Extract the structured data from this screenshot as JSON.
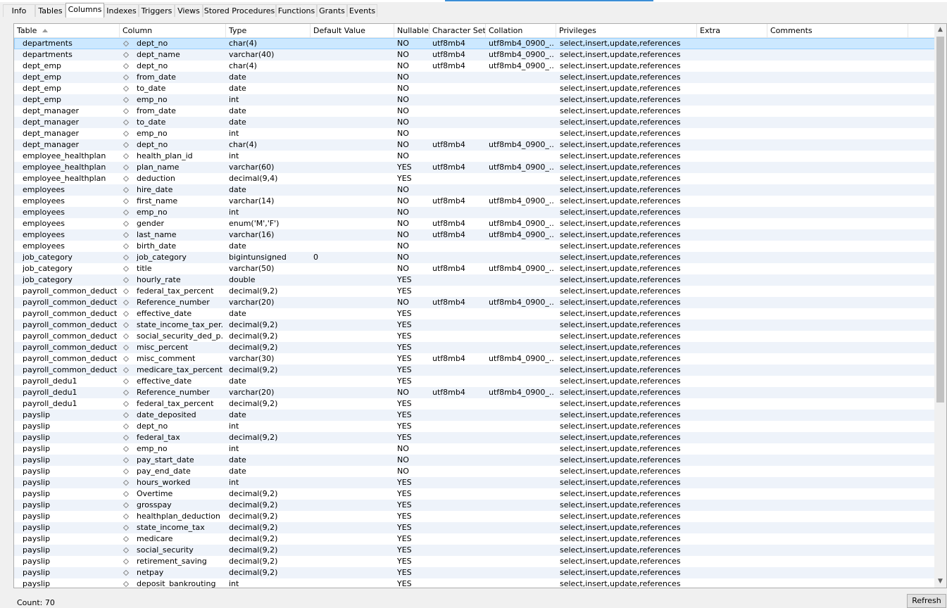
{
  "tabs": [
    "Info",
    "Tables",
    "Columns",
    "Indexes",
    "Triggers",
    "Views",
    "Stored Procedures",
    "Functions",
    "Grants",
    "Events"
  ],
  "active_tab": "Columns",
  "columns": [
    "Table",
    "Column",
    "Type",
    "Default Value",
    "Nullable",
    "Character Set",
    "Collation",
    "Privileges",
    "Extra",
    "Comments"
  ],
  "sorted_column": "Table",
  "rows": [
    [
      "departments",
      "dept_no",
      "char(4)",
      "",
      "NO",
      "utf8mb4",
      "utf8mb4_0900_...",
      "select,insert,update,references",
      "",
      ""
    ],
    [
      "departments",
      "dept_name",
      "varchar(40)",
      "",
      "NO",
      "utf8mb4",
      "utf8mb4_0900_...",
      "select,insert,update,references",
      "",
      ""
    ],
    [
      "dept_emp",
      "dept_no",
      "char(4)",
      "",
      "NO",
      "utf8mb4",
      "utf8mb4_0900_...",
      "select,insert,update,references",
      "",
      ""
    ],
    [
      "dept_emp",
      "from_date",
      "date",
      "",
      "NO",
      "",
      "",
      "select,insert,update,references",
      "",
      ""
    ],
    [
      "dept_emp",
      "to_date",
      "date",
      "",
      "NO",
      "",
      "",
      "select,insert,update,references",
      "",
      ""
    ],
    [
      "dept_emp",
      "emp_no",
      "int",
      "",
      "NO",
      "",
      "",
      "select,insert,update,references",
      "",
      ""
    ],
    [
      "dept_manager",
      "from_date",
      "date",
      "",
      "NO",
      "",
      "",
      "select,insert,update,references",
      "",
      ""
    ],
    [
      "dept_manager",
      "to_date",
      "date",
      "",
      "NO",
      "",
      "",
      "select,insert,update,references",
      "",
      ""
    ],
    [
      "dept_manager",
      "emp_no",
      "int",
      "",
      "NO",
      "",
      "",
      "select,insert,update,references",
      "",
      ""
    ],
    [
      "dept_manager",
      "dept_no",
      "char(4)",
      "",
      "NO",
      "utf8mb4",
      "utf8mb4_0900_...",
      "select,insert,update,references",
      "",
      ""
    ],
    [
      "employee_healthplan",
      "health_plan_id",
      "int",
      "",
      "NO",
      "",
      "",
      "select,insert,update,references",
      "",
      ""
    ],
    [
      "employee_healthplan",
      "plan_name",
      "varchar(60)",
      "",
      "YES",
      "utf8mb4",
      "utf8mb4_0900_...",
      "select,insert,update,references",
      "",
      ""
    ],
    [
      "employee_healthplan",
      "deduction",
      "decimal(9,4)",
      "",
      "YES",
      "",
      "",
      "select,insert,update,references",
      "",
      ""
    ],
    [
      "employees",
      "hire_date",
      "date",
      "",
      "NO",
      "",
      "",
      "select,insert,update,references",
      "",
      ""
    ],
    [
      "employees",
      "first_name",
      "varchar(14)",
      "",
      "NO",
      "utf8mb4",
      "utf8mb4_0900_...",
      "select,insert,update,references",
      "",
      ""
    ],
    [
      "employees",
      "emp_no",
      "int",
      "",
      "NO",
      "",
      "",
      "select,insert,update,references",
      "",
      ""
    ],
    [
      "employees",
      "gender",
      "enum('M','F')",
      "",
      "NO",
      "utf8mb4",
      "utf8mb4_0900_...",
      "select,insert,update,references",
      "",
      ""
    ],
    [
      "employees",
      "last_name",
      "varchar(16)",
      "",
      "NO",
      "utf8mb4",
      "utf8mb4_0900_...",
      "select,insert,update,references",
      "",
      ""
    ],
    [
      "employees",
      "birth_date",
      "date",
      "",
      "NO",
      "",
      "",
      "select,insert,update,references",
      "",
      ""
    ],
    [
      "job_category",
      "job_category",
      "bigintunsigned",
      "0",
      "NO",
      "",
      "",
      "select,insert,update,references",
      "",
      ""
    ],
    [
      "job_category",
      "title",
      "varchar(50)",
      "",
      "NO",
      "utf8mb4",
      "utf8mb4_0900_...",
      "select,insert,update,references",
      "",
      ""
    ],
    [
      "job_category",
      "hourly_rate",
      "double",
      "",
      "YES",
      "",
      "",
      "select,insert,update,references",
      "",
      ""
    ],
    [
      "payroll_common_deducti...",
      "federal_tax_percent",
      "decimal(9,2)",
      "",
      "YES",
      "",
      "",
      "select,insert,update,references",
      "",
      ""
    ],
    [
      "payroll_common_deducti...",
      "Reference_number",
      "varchar(20)",
      "",
      "NO",
      "utf8mb4",
      "utf8mb4_0900_...",
      "select,insert,update,references",
      "",
      ""
    ],
    [
      "payroll_common_deducti...",
      "effective_date",
      "date",
      "",
      "YES",
      "",
      "",
      "select,insert,update,references",
      "",
      ""
    ],
    [
      "payroll_common_deducti...",
      "state_income_tax_per...",
      "decimal(9,2)",
      "",
      "YES",
      "",
      "",
      "select,insert,update,references",
      "",
      ""
    ],
    [
      "payroll_common_deducti...",
      "social_security_ded_p...",
      "decimal(9,2)",
      "",
      "YES",
      "",
      "",
      "select,insert,update,references",
      "",
      ""
    ],
    [
      "payroll_common_deducti...",
      "misc_percent",
      "decimal(9,2)",
      "",
      "YES",
      "",
      "",
      "select,insert,update,references",
      "",
      ""
    ],
    [
      "payroll_common_deducti...",
      "misc_comment",
      "varchar(30)",
      "",
      "YES",
      "utf8mb4",
      "utf8mb4_0900_...",
      "select,insert,update,references",
      "",
      ""
    ],
    [
      "payroll_common_deducti...",
      "medicare_tax_percent",
      "decimal(9,2)",
      "",
      "YES",
      "",
      "",
      "select,insert,update,references",
      "",
      ""
    ],
    [
      "payroll_dedu1",
      "effective_date",
      "date",
      "",
      "YES",
      "",
      "",
      "select,insert,update,references",
      "",
      ""
    ],
    [
      "payroll_dedu1",
      "Reference_number",
      "varchar(20)",
      "",
      "NO",
      "utf8mb4",
      "utf8mb4_0900_...",
      "select,insert,update,references",
      "",
      ""
    ],
    [
      "payroll_dedu1",
      "federal_tax_percent",
      "decimal(9,2)",
      "",
      "YES",
      "",
      "",
      "select,insert,update,references",
      "",
      ""
    ],
    [
      "payslip",
      "date_deposited",
      "date",
      "",
      "YES",
      "",
      "",
      "select,insert,update,references",
      "",
      ""
    ],
    [
      "payslip",
      "dept_no",
      "int",
      "",
      "YES",
      "",
      "",
      "select,insert,update,references",
      "",
      ""
    ],
    [
      "payslip",
      "federal_tax",
      "decimal(9,2)",
      "",
      "YES",
      "",
      "",
      "select,insert,update,references",
      "",
      ""
    ],
    [
      "payslip",
      "emp_no",
      "int",
      "",
      "NO",
      "",
      "",
      "select,insert,update,references",
      "",
      ""
    ],
    [
      "payslip",
      "pay_start_date",
      "date",
      "",
      "NO",
      "",
      "",
      "select,insert,update,references",
      "",
      ""
    ],
    [
      "payslip",
      "pay_end_date",
      "date",
      "",
      "NO",
      "",
      "",
      "select,insert,update,references",
      "",
      ""
    ],
    [
      "payslip",
      "hours_worked",
      "int",
      "",
      "YES",
      "",
      "",
      "select,insert,update,references",
      "",
      ""
    ],
    [
      "payslip",
      "Overtime",
      "decimal(9,2)",
      "",
      "YES",
      "",
      "",
      "select,insert,update,references",
      "",
      ""
    ],
    [
      "payslip",
      "grosspay",
      "decimal(9,2)",
      "",
      "YES",
      "",
      "",
      "select,insert,update,references",
      "",
      ""
    ],
    [
      "payslip",
      "healthplan_deduction",
      "decimal(9,2)",
      "",
      "YES",
      "",
      "",
      "select,insert,update,references",
      "",
      ""
    ],
    [
      "payslip",
      "state_income_tax",
      "decimal(9,2)",
      "",
      "YES",
      "",
      "",
      "select,insert,update,references",
      "",
      ""
    ],
    [
      "payslip",
      "medicare",
      "decimal(9,2)",
      "",
      "YES",
      "",
      "",
      "select,insert,update,references",
      "",
      ""
    ],
    [
      "payslip",
      "social_security",
      "decimal(9,2)",
      "",
      "YES",
      "",
      "",
      "select,insert,update,references",
      "",
      ""
    ],
    [
      "payslip",
      "retirement_saving",
      "decimal(9,2)",
      "",
      "YES",
      "",
      "",
      "select,insert,update,references",
      "",
      ""
    ],
    [
      "payslip",
      "netpay",
      "decimal(9,2)",
      "",
      "YES",
      "",
      "",
      "select,insert,update,references",
      "",
      ""
    ],
    [
      "payslip",
      "deposit_bankrouting",
      "int",
      "",
      "YES",
      "",
      "",
      "select,insert,update,references",
      "",
      ""
    ]
  ],
  "selected_row": 0,
  "status": {
    "count_label": "Count: 70"
  },
  "refresh_label": "Refresh",
  "colors": {
    "selected_row": "#cce8ff",
    "alt_row": "#eef3fa",
    "accent": "#3b8ed6"
  }
}
